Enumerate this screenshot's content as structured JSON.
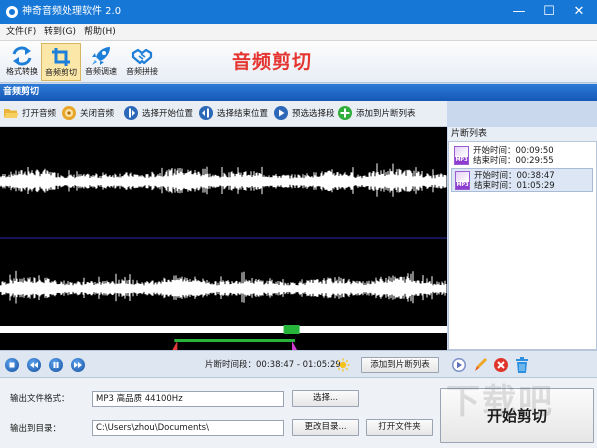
{
  "window": {
    "title": "神奇音频处理软件 2.0",
    "minimize_glyph": "—",
    "maximize_glyph": "☐",
    "close_glyph": "✕"
  },
  "menu": [
    {
      "label": "文件(F)"
    },
    {
      "label": "转到(G)"
    },
    {
      "label": "帮助(H)"
    }
  ],
  "toolbar": {
    "tools": [
      {
        "label": "格式转换",
        "icon": "convert-arrows-icon"
      },
      {
        "label": "音频剪切",
        "icon": "crop-icon",
        "active": true
      },
      {
        "label": "音频调速",
        "icon": "rocket-icon"
      },
      {
        "label": "音频拼接",
        "icon": "handshake-icon"
      }
    ],
    "section_heading": "音频剪切"
  },
  "panel": {
    "header": "音频剪切"
  },
  "actions": [
    {
      "label": "打开音频",
      "icon": "folder-open-icon",
      "color": "#e6a92c"
    },
    {
      "label": "关闭音频",
      "icon": "close-audio-icon",
      "color": "#e8a62a"
    },
    {
      "label": "选择开始位置",
      "icon": "start-marker-icon",
      "color": "#2d68b8"
    },
    {
      "label": "选择结束位置",
      "icon": "end-marker-icon",
      "color": "#2d68b8"
    },
    {
      "label": "预选选择段",
      "icon": "preview-icon",
      "color": "#2d68b8"
    },
    {
      "label": "添加到片断列表",
      "icon": "add-plus-icon",
      "color": "#2eae3a"
    }
  ],
  "clip_list": {
    "title": "片断列表",
    "badge": "MP3",
    "items": [
      {
        "start": "开始时间：00:09:50",
        "end": "结束时间：00:29:55"
      },
      {
        "start": "开始时间：00:38:47",
        "end": "结束时间：01:05:29",
        "selected": true
      }
    ]
  },
  "playback": {
    "segment_label": "片断时间段：00:38:47 - 01:05:29",
    "add_button": "添加到片断列表",
    "selection_start_fraction": 0.39,
    "selection_end_fraction": 0.66,
    "playhead_fraction": 0.65
  },
  "output": {
    "format_label": "输出文件格式：",
    "format_value": "MP3 高品质 44100Hz",
    "select_button": "选择...",
    "dir_label": "输出到目录：",
    "dir_value": "C:\\Users\\zhou\\Documents\\",
    "change_dir_button": "更改目录...",
    "open_folder_button": "打开文件夹",
    "start_button": "开始剪切"
  },
  "watermark": "下载吧",
  "colors": {
    "accent": "#1677d6",
    "heading": "#e53531",
    "waveform": "#ffffff",
    "selection": "#27b43a",
    "divider": "#2a2ab0"
  }
}
